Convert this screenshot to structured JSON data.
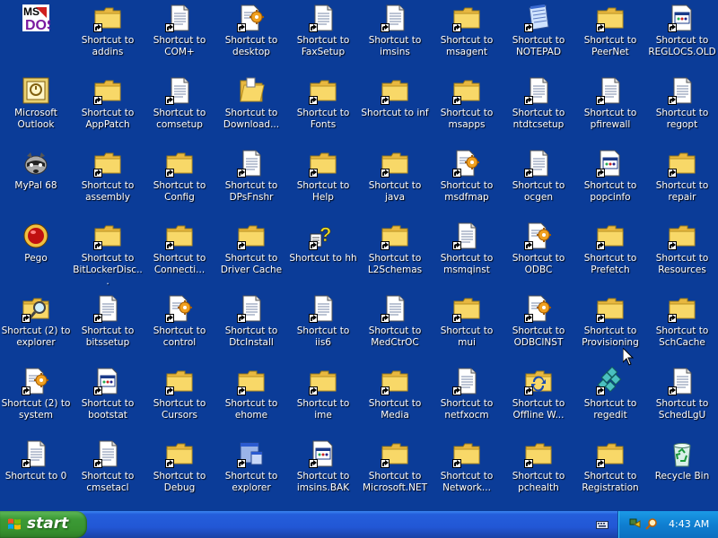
{
  "desktop": {
    "icons": [
      {
        "label": "",
        "icon": "ms-dos-icon",
        "type": "msdos",
        "shortcut": false
      },
      {
        "label": "Shortcut to addins",
        "icon": "folder-icon",
        "type": "folder",
        "shortcut": true
      },
      {
        "label": "Shortcut to COM+",
        "icon": "document-icon",
        "type": "doc",
        "shortcut": true
      },
      {
        "label": "Shortcut to desktop",
        "icon": "settings-document-icon",
        "type": "docgear",
        "shortcut": true
      },
      {
        "label": "Shortcut to FaxSetup",
        "icon": "document-icon",
        "type": "doc",
        "shortcut": true
      },
      {
        "label": "Shortcut to imsins",
        "icon": "document-icon",
        "type": "doc",
        "shortcut": true
      },
      {
        "label": "Shortcut to msagent",
        "icon": "folder-icon",
        "type": "folder",
        "shortcut": true
      },
      {
        "label": "Shortcut to NOTEPAD",
        "icon": "notepad-icon",
        "type": "notepad",
        "shortcut": true
      },
      {
        "label": "Shortcut to PeerNet",
        "icon": "folder-icon",
        "type": "folder",
        "shortcut": true
      },
      {
        "label": "Shortcut to REGLOCS.OLD",
        "icon": "window-document-icon",
        "type": "docwin",
        "shortcut": true
      },
      {
        "label": "Microsoft Outlook",
        "icon": "outlook-icon",
        "type": "outlook",
        "shortcut": false
      },
      {
        "label": "Shortcut to AppPatch",
        "icon": "folder-icon",
        "type": "folder",
        "shortcut": true
      },
      {
        "label": "Shortcut to comsetup",
        "icon": "document-icon",
        "type": "doc",
        "shortcut": true
      },
      {
        "label": "Shortcut to Download...",
        "icon": "open-folder-icon",
        "type": "openfolder",
        "shortcut": false
      },
      {
        "label": "Shortcut to Fonts",
        "icon": "folder-icon",
        "type": "folder",
        "shortcut": true
      },
      {
        "label": "Shortcut to inf",
        "icon": "folder-icon",
        "type": "folder",
        "shortcut": true
      },
      {
        "label": "Shortcut to msapps",
        "icon": "folder-icon",
        "type": "folder",
        "shortcut": true
      },
      {
        "label": "Shortcut to ntdtcsetup",
        "icon": "document-icon",
        "type": "doc",
        "shortcut": true
      },
      {
        "label": "Shortcut to pfirewall",
        "icon": "document-icon",
        "type": "doc",
        "shortcut": true
      },
      {
        "label": "Shortcut to regopt",
        "icon": "document-icon",
        "type": "doc",
        "shortcut": true
      },
      {
        "label": "MyPal 68",
        "icon": "raccoon-icon",
        "type": "raccoon",
        "shortcut": false
      },
      {
        "label": "Shortcut to assembly",
        "icon": "folder-icon",
        "type": "folder",
        "shortcut": true
      },
      {
        "label": "Shortcut to Config",
        "icon": "folder-icon",
        "type": "folder",
        "shortcut": true
      },
      {
        "label": "Shortcut to DPsFnshr",
        "icon": "document-icon",
        "type": "doc",
        "shortcut": true
      },
      {
        "label": "Shortcut to Help",
        "icon": "folder-icon",
        "type": "folder",
        "shortcut": true
      },
      {
        "label": "Shortcut to java",
        "icon": "folder-icon",
        "type": "folder",
        "shortcut": true
      },
      {
        "label": "Shortcut to msdfmap",
        "icon": "settings-document-icon",
        "type": "docgear",
        "shortcut": true
      },
      {
        "label": "Shortcut to ocgen",
        "icon": "document-icon",
        "type": "doc",
        "shortcut": true
      },
      {
        "label": "Shortcut to popcinfo",
        "icon": "window-document-icon",
        "type": "docwin",
        "shortcut": true
      },
      {
        "label": "Shortcut to repair",
        "icon": "folder-icon",
        "type": "folder",
        "shortcut": true
      },
      {
        "label": "Pego",
        "icon": "pego-icon",
        "type": "pego",
        "shortcut": false
      },
      {
        "label": "Shortcut to BitLockerDisc...",
        "icon": "folder-icon",
        "type": "folder",
        "shortcut": true
      },
      {
        "label": "Shortcut to Connecti...",
        "icon": "folder-icon",
        "type": "folder",
        "shortcut": true
      },
      {
        "label": "Shortcut to Driver Cache",
        "icon": "folder-icon",
        "type": "folder",
        "shortcut": true
      },
      {
        "label": "Shortcut to hh",
        "icon": "help-icon",
        "type": "help",
        "shortcut": true
      },
      {
        "label": "Shortcut to L2Schemas",
        "icon": "folder-icon",
        "type": "folder",
        "shortcut": true
      },
      {
        "label": "Shortcut to msmqinst",
        "icon": "document-icon",
        "type": "doc",
        "shortcut": true
      },
      {
        "label": "Shortcut to ODBC",
        "icon": "settings-document-icon",
        "type": "docgear",
        "shortcut": true
      },
      {
        "label": "Shortcut to Prefetch",
        "icon": "folder-icon",
        "type": "folder",
        "shortcut": true
      },
      {
        "label": "Shortcut to Resources",
        "icon": "folder-icon",
        "type": "folder",
        "shortcut": true
      },
      {
        "label": "Shortcut (2) to explorer",
        "icon": "search-folder-icon",
        "type": "searchfolder",
        "shortcut": true
      },
      {
        "label": "Shortcut to bitssetup",
        "icon": "document-icon",
        "type": "doc",
        "shortcut": true
      },
      {
        "label": "Shortcut to control",
        "icon": "settings-document-icon",
        "type": "docgear",
        "shortcut": true
      },
      {
        "label": "Shortcut to DtcInstall",
        "icon": "document-icon",
        "type": "doc",
        "shortcut": true
      },
      {
        "label": "Shortcut to iis6",
        "icon": "document-icon",
        "type": "doc",
        "shortcut": true
      },
      {
        "label": "Shortcut to MedCtrOC",
        "icon": "document-icon",
        "type": "doc",
        "shortcut": true
      },
      {
        "label": "Shortcut to mui",
        "icon": "folder-icon",
        "type": "folder",
        "shortcut": true
      },
      {
        "label": "Shortcut to ODBCINST",
        "icon": "settings-document-icon",
        "type": "docgear",
        "shortcut": true
      },
      {
        "label": "Shortcut to Provisioning",
        "icon": "folder-icon",
        "type": "folder",
        "shortcut": true
      },
      {
        "label": "Shortcut to SchCache",
        "icon": "folder-icon",
        "type": "folder",
        "shortcut": true
      },
      {
        "label": "Shortcut (2) to system",
        "icon": "settings-document-icon",
        "type": "docgear",
        "shortcut": true
      },
      {
        "label": "Shortcut to bootstat",
        "icon": "window-document-icon",
        "type": "docwin",
        "shortcut": true
      },
      {
        "label": "Shortcut to Cursors",
        "icon": "folder-icon",
        "type": "folder",
        "shortcut": true
      },
      {
        "label": "Shortcut to ehome",
        "icon": "folder-icon",
        "type": "folder",
        "shortcut": true
      },
      {
        "label": "Shortcut to ime",
        "icon": "folder-icon",
        "type": "folder",
        "shortcut": true
      },
      {
        "label": "Shortcut to Media",
        "icon": "folder-icon",
        "type": "folder",
        "shortcut": true
      },
      {
        "label": "Shortcut to netfxocm",
        "icon": "document-icon",
        "type": "doc",
        "shortcut": true
      },
      {
        "label": "Shortcut to Offline W...",
        "icon": "sync-folder-icon",
        "type": "syncfolder",
        "shortcut": true
      },
      {
        "label": "Shortcut to regedit",
        "icon": "regedit-icon",
        "type": "regedit",
        "shortcut": true
      },
      {
        "label": "Shortcut to SchedLgU",
        "icon": "document-icon",
        "type": "doc",
        "shortcut": true
      },
      {
        "label": "Shortcut to 0",
        "icon": "document-icon",
        "type": "doc",
        "shortcut": true
      },
      {
        "label": "Shortcut to cmsetacl",
        "icon": "document-icon",
        "type": "doc",
        "shortcut": true
      },
      {
        "label": "Shortcut to Debug",
        "icon": "folder-icon",
        "type": "folder",
        "shortcut": true
      },
      {
        "label": "Shortcut to explorer",
        "icon": "explorer-icon",
        "type": "explorer",
        "shortcut": true
      },
      {
        "label": "Shortcut to imsins.BAK",
        "icon": "window-document-icon",
        "type": "docwin",
        "shortcut": true
      },
      {
        "label": "Shortcut to Microsoft.NET",
        "icon": "folder-icon",
        "type": "folder",
        "shortcut": true
      },
      {
        "label": "Shortcut to Network...",
        "icon": "folder-icon",
        "type": "folder",
        "shortcut": true
      },
      {
        "label": "Shortcut to pchealth",
        "icon": "folder-icon",
        "type": "folder",
        "shortcut": true
      },
      {
        "label": "Shortcut to Registration",
        "icon": "folder-icon",
        "type": "folder",
        "shortcut": true
      },
      {
        "label": "Recycle Bin",
        "icon": "recycle-bin-icon",
        "type": "recycle",
        "shortcut": false
      }
    ]
  },
  "taskbar": {
    "start_label": "start",
    "clock": "4:43 AM",
    "colors": {
      "taskbar": "#245edb",
      "start": "#3c9a36",
      "tray": "#0f7fd1",
      "desktop": "#0b3c98"
    }
  }
}
